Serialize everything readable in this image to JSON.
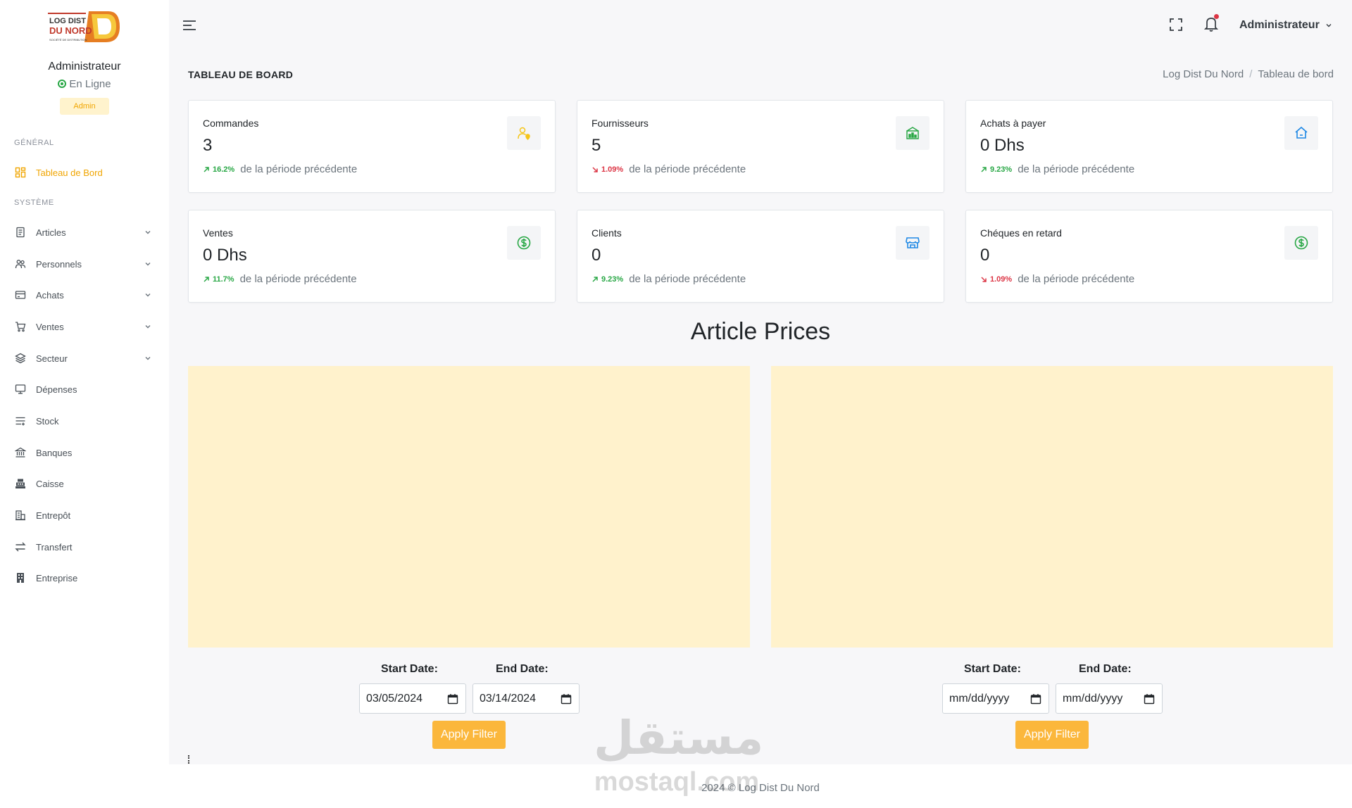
{
  "brand": {
    "logo_line1": "LOG DIST",
    "logo_line2": "DU NORD",
    "logo_tagline": "SOCIÉTÉ DE DISTRIBUTION"
  },
  "user": {
    "name": "Administrateur",
    "status": "En Ligne",
    "role": "Admin"
  },
  "sidebar": {
    "section_general": "GÉNÉRAL",
    "section_system": "SYSTÈME",
    "dashboard": "Tableau de Bord",
    "items": [
      {
        "label": "Articles",
        "icon": "document-icon"
      },
      {
        "label": "Personnels",
        "icon": "users-icon"
      },
      {
        "label": "Achats",
        "icon": "card-icon"
      },
      {
        "label": "Ventes",
        "icon": "cart-icon"
      },
      {
        "label": "Secteur",
        "icon": "layers-icon"
      },
      {
        "label": "Dépenses",
        "icon": "monitor-icon"
      },
      {
        "label": "Stock",
        "icon": "sliders-icon"
      },
      {
        "label": "Banques",
        "icon": "bank-icon"
      },
      {
        "label": "Caisse",
        "icon": "register-icon"
      },
      {
        "label": "Entrepôt",
        "icon": "warehouse-icon"
      },
      {
        "label": "Transfert",
        "icon": "transfer-icon"
      },
      {
        "label": "Entreprise",
        "icon": "building-icon"
      }
    ]
  },
  "topbar": {
    "admin_label": "Administrateur"
  },
  "page": {
    "title": "TABLEAU DE BOARD",
    "breadcrumb": [
      "Log Dist Du Nord",
      "Tableau de bord"
    ]
  },
  "cards": [
    {
      "title": "Commandes",
      "value": "3",
      "pct": "16.2%",
      "trend": "up",
      "suffix": "de la période précédente",
      "icon": "user-pin-icon",
      "color": "#f5c518"
    },
    {
      "title": "Fournisseurs",
      "value": "5",
      "pct": "1.09%",
      "trend": "down",
      "suffix": "de la période précédente",
      "icon": "building-chart-icon",
      "color": "#28a745"
    },
    {
      "title": "Achats à payer",
      "value": "0 Dhs",
      "pct": "9.23%",
      "trend": "up",
      "suffix": "de la période précédente",
      "icon": "home-icon",
      "color": "#1e88e5"
    },
    {
      "title": "Ventes",
      "value": "0 Dhs",
      "pct": "11.7%",
      "trend": "up",
      "suffix": "de la période précédente",
      "icon": "dollar-circle-icon",
      "color": "#28a745"
    },
    {
      "title": "Clients",
      "value": "0",
      "pct": "9.23%",
      "trend": "up",
      "suffix": "de la période précédente",
      "icon": "store-icon",
      "color": "#1e88e5"
    },
    {
      "title": "Chéques en retard",
      "value": "0",
      "pct": "1.09%",
      "trend": "down",
      "suffix": "de la période précédente",
      "icon": "dollar-circle-icon",
      "color": "#28a745"
    }
  ],
  "section": {
    "title": "Article Prices"
  },
  "filters": [
    {
      "start_label": "Start Date:",
      "end_label": "End Date:",
      "start_value": "03/05/2024",
      "end_value": "03/14/2024",
      "button": "Apply Filter"
    },
    {
      "start_label": "Start Date:",
      "end_label": "End Date:",
      "start_value": "mm/dd/yyyy",
      "end_value": "mm/dd/yyyy",
      "button": "Apply Filter"
    }
  ],
  "footer": {
    "text": "2024 © Log Dist Du Nord"
  },
  "watermark": {
    "arabic": "مستقل",
    "latin": "mostaql.com"
  },
  "colors": {
    "accent": "#f0a500",
    "button": "#fbb73c",
    "chart_bg": "#fff2cc",
    "up": "#28a745",
    "down": "#dc3545"
  }
}
